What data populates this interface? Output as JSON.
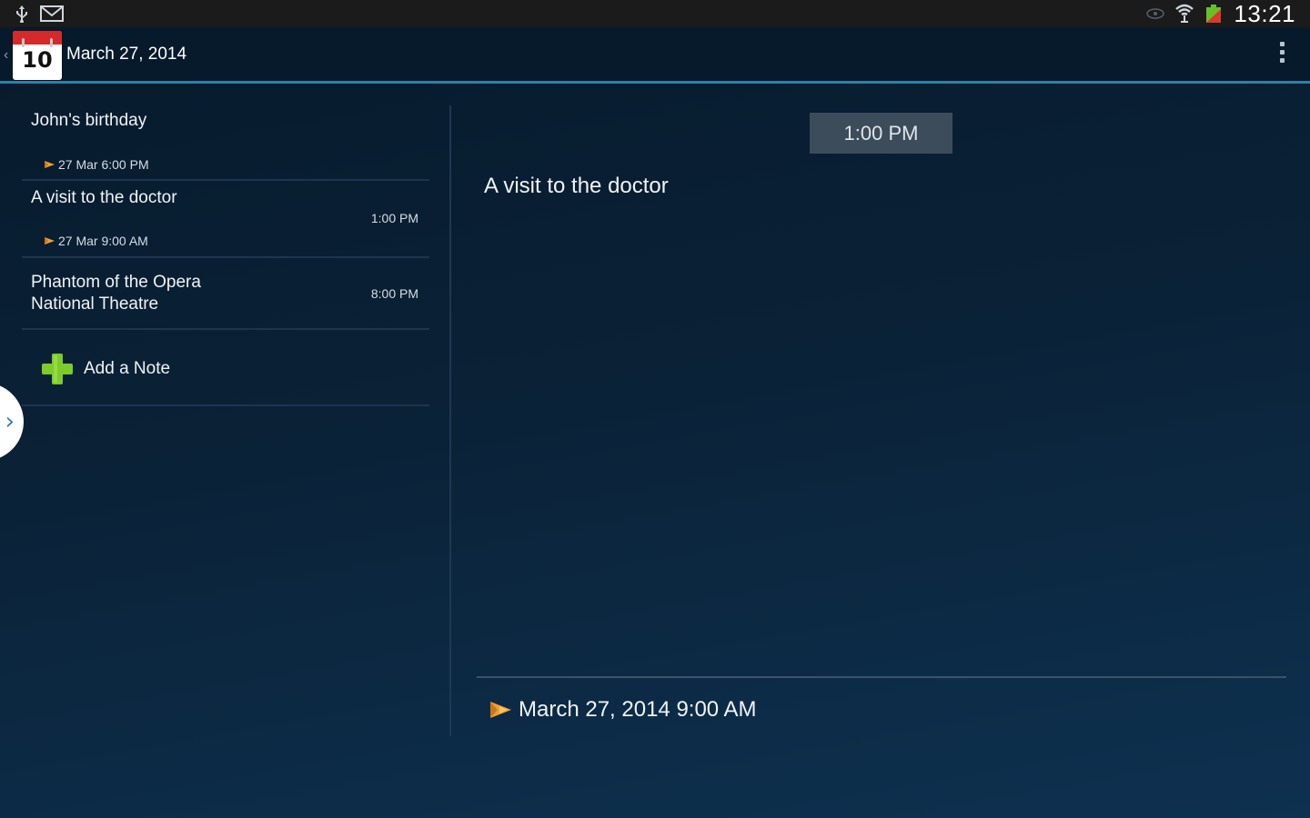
{
  "status_bar": {
    "clock": "13:21",
    "icons": [
      "usb-icon",
      "gmail-icon",
      "eye-icon",
      "wifi-icon",
      "battery-icon"
    ]
  },
  "action_bar": {
    "app_icon_day": "10",
    "title": "March 27, 2014",
    "overflow_icon": "overflow-menu-icon"
  },
  "list": {
    "items": [
      {
        "title": "John's birthday",
        "time": "",
        "alarm": "27 Mar 6:00 PM"
      },
      {
        "title": "A visit to the doctor",
        "time": "1:00 PM",
        "alarm": "27 Mar 9:00 AM"
      },
      {
        "title": "Phantom of the Opera",
        "subtitle": "National Theatre",
        "time": "8:00 PM",
        "alarm": ""
      }
    ],
    "add_note_label": "Add a Note"
  },
  "detail": {
    "time": "1:00 PM",
    "title": "A visit to the doctor",
    "reminder": "March 27, 2014 9:00 AM"
  },
  "colors": {
    "accent_line": "#2e7fa8",
    "app_icon_red": "#d42a2a",
    "plus_green": "#7ccc2a",
    "bell_orange": "#f0a030",
    "pill_bg": "#3d4c5b"
  }
}
